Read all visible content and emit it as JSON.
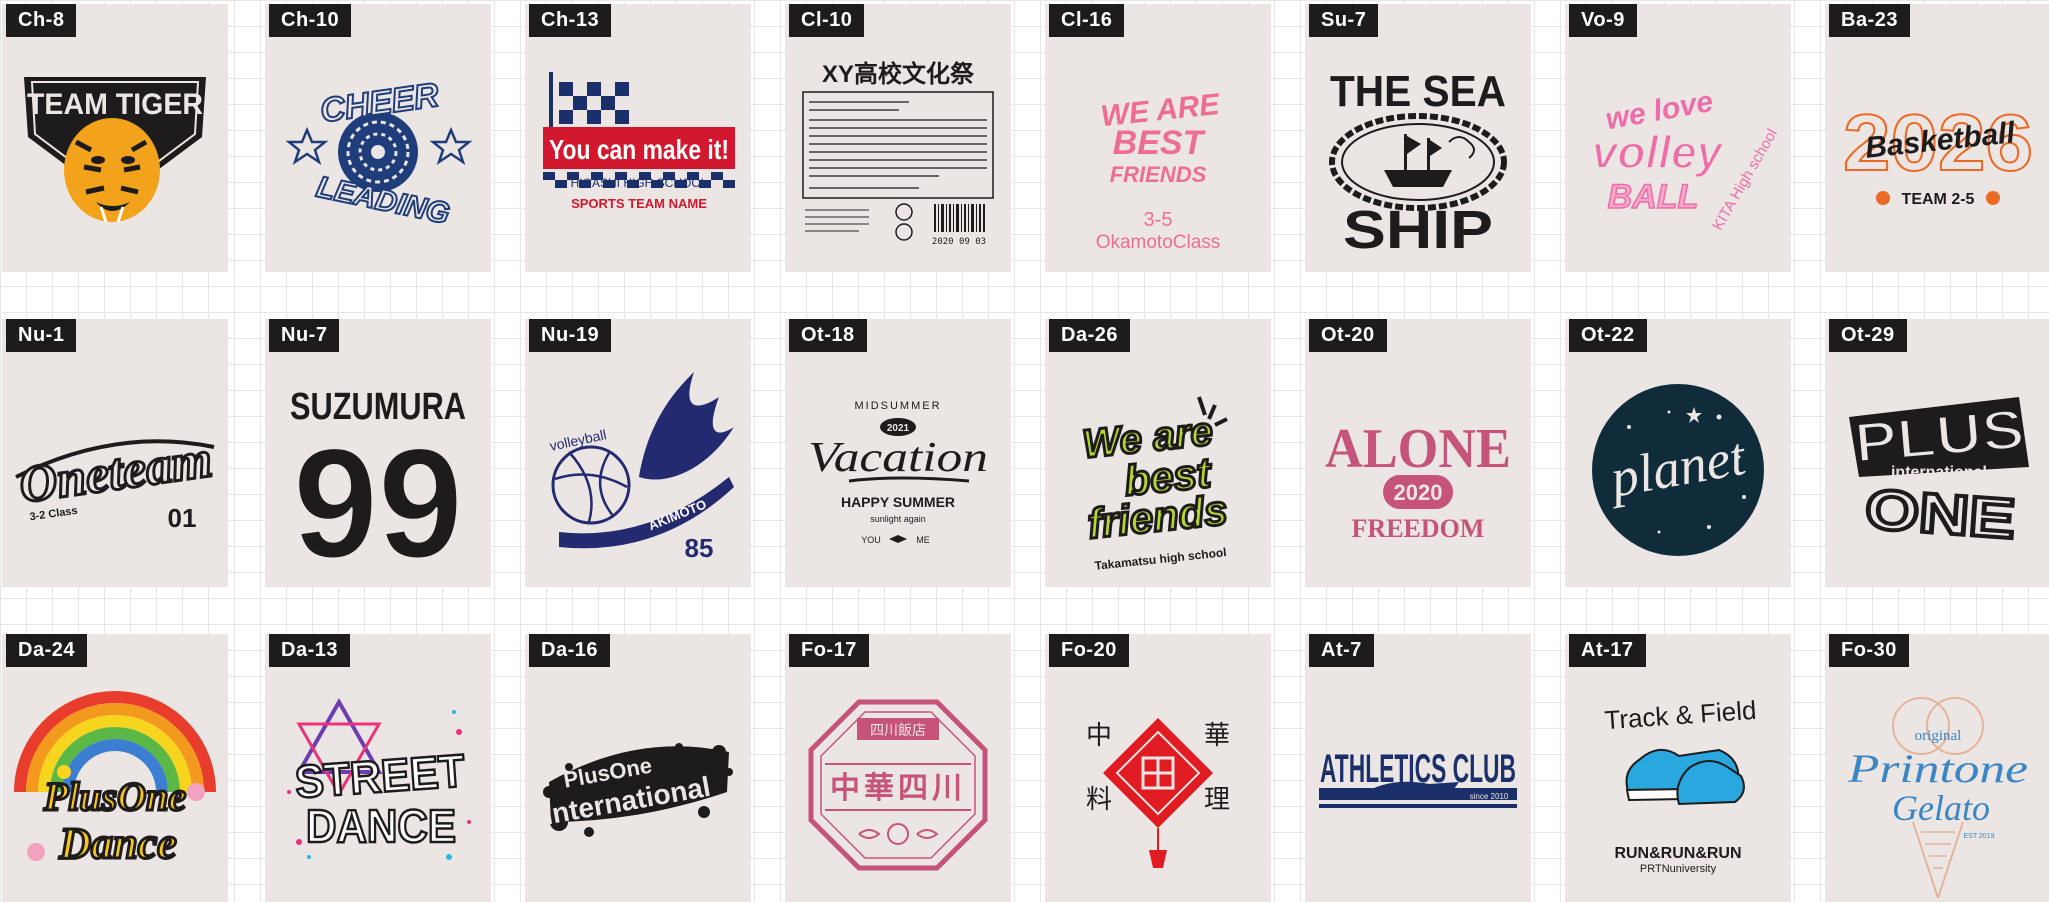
{
  "designs": [
    {
      "code": "Ch-8",
      "texts": [
        "TEAM TIGER"
      ]
    },
    {
      "code": "Ch-10",
      "texts": [
        "CHEER",
        "LEADING"
      ]
    },
    {
      "code": "Ch-13",
      "texts": [
        "You can make it!",
        "HIGASHI HIGH SCHOOL",
        "SPORTS TEAM NAME"
      ]
    },
    {
      "code": "Cl-10",
      "texts": [
        "XY高校文化祭",
        "2020 09 03"
      ]
    },
    {
      "code": "Cl-16",
      "texts": [
        "WE ARE",
        "BEST",
        "FRIENDS",
        "3-5",
        "OkamotoClass"
      ]
    },
    {
      "code": "Su-7",
      "texts": [
        "THE SEA",
        "SHIP"
      ]
    },
    {
      "code": "Vo-9",
      "texts": [
        "we love",
        "volley",
        "BALL",
        "KITA High school"
      ]
    },
    {
      "code": "Ba-23",
      "texts": [
        "2026",
        "Basketball",
        "TEAM 2-5"
      ]
    },
    {
      "code": "Nu-1",
      "texts": [
        "Oneteam",
        "3-2 Class",
        "01"
      ]
    },
    {
      "code": "Nu-7",
      "texts": [
        "SUZUMURA",
        "99"
      ]
    },
    {
      "code": "Nu-19",
      "texts": [
        "volleyball",
        "AKIMOTO",
        "85"
      ]
    },
    {
      "code": "Ot-18",
      "texts": [
        "MIDSUMMER",
        "2021",
        "Vacation",
        "HAPPY SUMMER",
        "sunlight again",
        "YOU",
        "ME"
      ]
    },
    {
      "code": "Da-26",
      "texts": [
        "We are",
        "best",
        "friends",
        "Takamatsu high school"
      ]
    },
    {
      "code": "Ot-20",
      "texts": [
        "ALONE",
        "2020",
        "FREEDOM"
      ]
    },
    {
      "code": "Ot-22",
      "texts": [
        "planet"
      ]
    },
    {
      "code": "Ot-29",
      "texts": [
        "PLUS",
        "international",
        "ONE"
      ]
    },
    {
      "code": "Da-24",
      "texts": [
        "PlusOne",
        "Dance"
      ]
    },
    {
      "code": "Da-13",
      "texts": [
        "STREET",
        "DANCE"
      ]
    },
    {
      "code": "Da-16",
      "texts": [
        "PlusOne",
        "International"
      ]
    },
    {
      "code": "Fo-17",
      "texts": [
        "四川飯店",
        "中華四川"
      ]
    },
    {
      "code": "Fo-20",
      "texts": [
        "中",
        "華",
        "料",
        "理"
      ]
    },
    {
      "code": "At-7",
      "texts": [
        "ATHLETICS CLUB",
        "since 2010"
      ]
    },
    {
      "code": "At-17",
      "texts": [
        "Track & Field",
        "RUN&RUN&RUN",
        "PRTNuniversity"
      ]
    },
    {
      "code": "Fo-30",
      "texts": [
        "original",
        "Printone",
        "Gelato",
        "EST 2019"
      ]
    }
  ]
}
